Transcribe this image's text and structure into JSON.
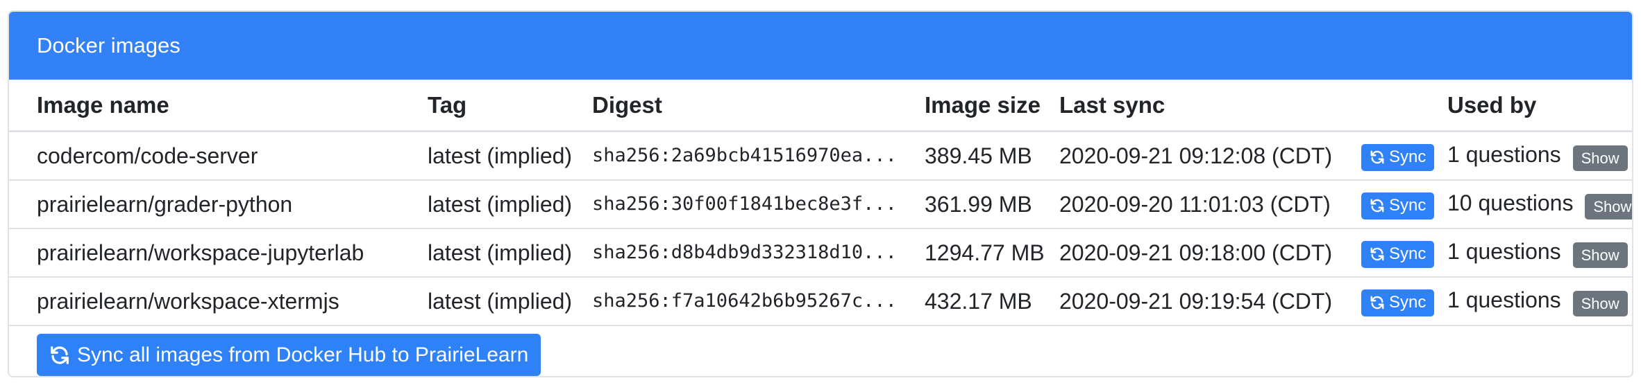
{
  "card": {
    "title": "Docker images"
  },
  "table": {
    "headers": {
      "image_name": "Image name",
      "tag": "Tag",
      "digest": "Digest",
      "image_size": "Image size",
      "last_sync": "Last sync",
      "used_by": "Used by"
    },
    "rows": [
      {
        "image_name": "codercom/code-server",
        "tag": "latest (implied)",
        "digest": "sha256:2a69bcb41516970ea...",
        "image_size": "389.45 MB",
        "last_sync": "2020-09-21 09:12:08 (CDT)",
        "sync_label": "Sync",
        "used_by": "1 questions",
        "show_label": "Show"
      },
      {
        "image_name": "prairielearn/grader-python",
        "tag": "latest (implied)",
        "digest": "sha256:30f00f1841bec8e3f...",
        "image_size": "361.99 MB",
        "last_sync": "2020-09-20 11:01:03 (CDT)",
        "sync_label": "Sync",
        "used_by": "10 questions",
        "show_label": "Show"
      },
      {
        "image_name": "prairielearn/workspace-jupyterlab",
        "tag": "latest (implied)",
        "digest": "sha256:d8b4db9d332318d10...",
        "image_size": "1294.77 MB",
        "last_sync": "2020-09-21 09:18:00 (CDT)",
        "sync_label": "Sync",
        "used_by": "1 questions",
        "show_label": "Show"
      },
      {
        "image_name": "prairielearn/workspace-xtermjs",
        "tag": "latest (implied)",
        "digest": "sha256:f7a10642b6b95267c...",
        "image_size": "432.17 MB",
        "last_sync": "2020-09-21 09:19:54 (CDT)",
        "sync_label": "Sync",
        "used_by": "1 questions",
        "show_label": "Show"
      }
    ]
  },
  "footer": {
    "sync_all_label": "Sync all images from Docker Hub to PrairieLearn"
  },
  "icons": {
    "sync": "sync-icon"
  },
  "colors": {
    "header_bg": "#3381f7",
    "primary_button": "#2f81f7",
    "secondary_button": "#6c757d"
  }
}
